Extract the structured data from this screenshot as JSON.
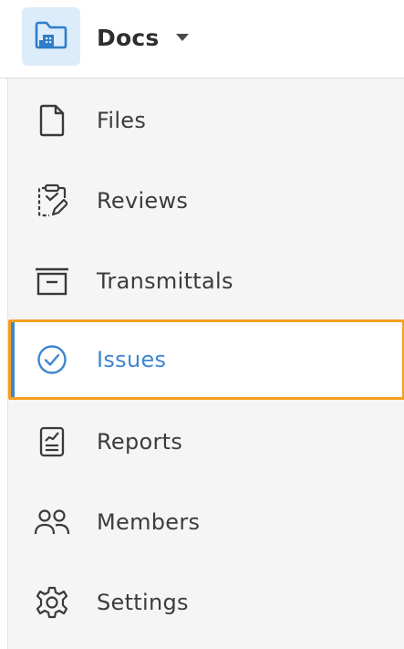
{
  "header": {
    "module_title": "Docs",
    "module_icon": "folder-building-icon",
    "caret_icon": "caret-down-icon"
  },
  "sidebar": {
    "items": [
      {
        "label": "Files",
        "icon": "file-icon",
        "active": false
      },
      {
        "label": "Reviews",
        "icon": "clipboard-review-icon",
        "active": false
      },
      {
        "label": "Transmittals",
        "icon": "archive-tray-icon",
        "active": false
      },
      {
        "label": "Issues",
        "icon": "check-circle-icon",
        "active": true
      },
      {
        "label": "Reports",
        "icon": "report-icon",
        "active": false
      },
      {
        "label": "Members",
        "icon": "members-icon",
        "active": false
      },
      {
        "label": "Settings",
        "icon": "gear-icon",
        "active": false
      }
    ]
  },
  "colors": {
    "accent": "#3f86cf",
    "highlight_outline": "#f5a01e",
    "sidebar_bg": "#f5f5f5",
    "badge_bg": "#dcecfa",
    "text": "#3c3c3c"
  }
}
